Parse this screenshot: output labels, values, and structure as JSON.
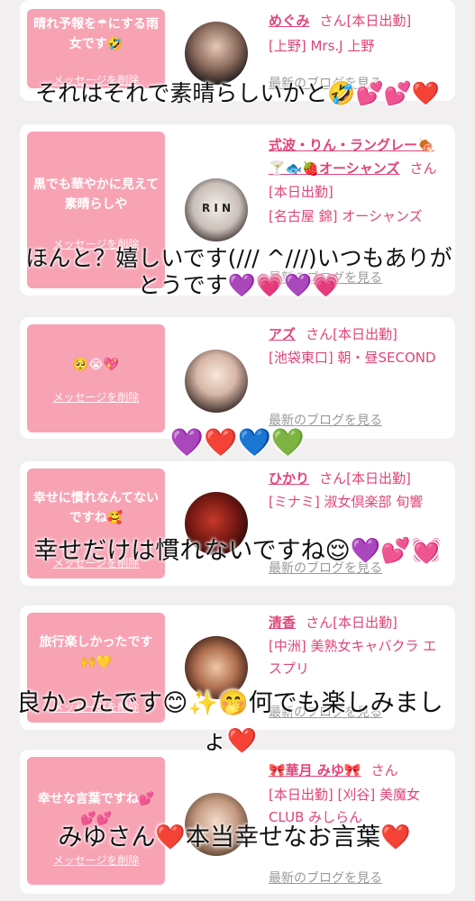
{
  "cards": [
    {
      "message": "晴れ予報を☂にする雨女です🤣",
      "delete_label": "メッセージを削除",
      "name": "めぐみ",
      "san": "さん[本日出勤]",
      "location": "[上野] Mrs.J 上野",
      "blog_label": "最新のブログを見る",
      "avatar_text": "",
      "overlay": "それはそれで素晴らしいかと🤣💕💕❤️"
    },
    {
      "message": "黒でも華やかに見えて素晴らしや",
      "delete_label": "メッセージを削除",
      "name": "式波・りん・ラングレー🍖🍸🐟🍓オーシャンズ",
      "san": "さん[本日出勤]",
      "location": "[名古屋 錦] オーシャンズ",
      "blog_label": "最新のブログを見る",
      "avatar_text": "R I N",
      "overlay": "ほんと？嬉しいです(/// ^///)いつもありがとうです💜💗💜💗"
    },
    {
      "message": "🥺😭💖",
      "delete_label": "メッセージを削除",
      "name": "アズ",
      "san": "さん[本日出勤]",
      "location": "[池袋東口] 朝・昼SECOND",
      "blog_label": "最新のブログを見る",
      "avatar_text": "",
      "overlay": "💜❤️💙💚"
    },
    {
      "message": "幸せに慣れなんてないですね🥰",
      "delete_label": "メッセージを削除",
      "name": "ひかり",
      "san": "さん[本日出勤]",
      "location": "[ミナミ] 淑女倶楽部 旬響",
      "blog_label": "最新のブログを見る",
      "avatar_text": "",
      "overlay": "幸せだけは慣れないですね😌💜💕💓"
    },
    {
      "message": "旅行楽しかったです🙌💛",
      "delete_label": "メッセージを削除",
      "name": "清香",
      "san": "さん[本日出勤]",
      "location": "[中洲] 美熟女キャバクラ エスプリ",
      "blog_label": "最新のブログを見る",
      "avatar_text": "",
      "overlay": "良かったです😊✨🤭何でも楽しみましょ❤️"
    },
    {
      "message": "幸せな言葉ですね💕💕💕",
      "delete_label": "メッセージを削除",
      "name": "🎀華月 みゆ🎀",
      "san": "さん",
      "location": "[本日出勤] [刈谷] 美魔女CLUB みしらん",
      "blog_label": "最新のブログを見る",
      "avatar_text": "",
      "overlay": "みゆさん❤️本当幸せなお言葉❤️"
    }
  ],
  "colors": {
    "bubble": "#f7a3b4",
    "accent": "#e0447a",
    "muted": "#999999"
  }
}
